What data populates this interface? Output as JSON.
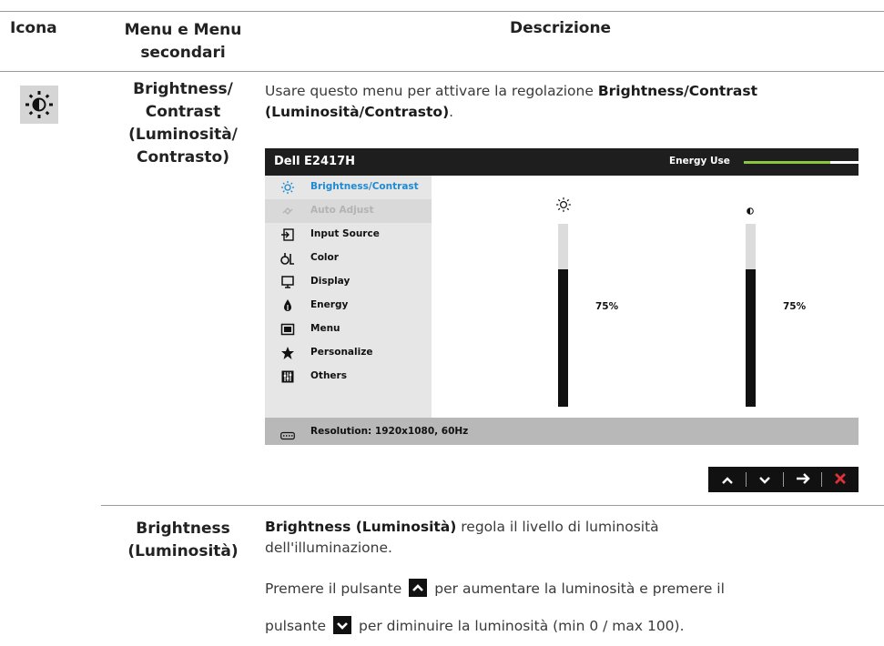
{
  "table": {
    "headers": {
      "icon": "Icona",
      "menu_line1": "Menu e Menu",
      "menu_line2": "secondari",
      "description": "Descrizione"
    }
  },
  "rows": [
    {
      "icon": "brightness-icon",
      "menu_lines": [
        "Brightness/",
        "Contrast",
        "(Luminosità/",
        "Contrasto)"
      ],
      "desc_prefix": "Usare questo menu per attivare la regolazione ",
      "desc_bold": "Brightness/Contrast (Luminosità/Contrasto)",
      "desc_suffix": "."
    },
    {
      "menu_lines": [
        "Brightness",
        "(Luminosità)"
      ],
      "desc_bold": "Brightness (Luminosità)",
      "desc_rest": " regola il livello di luminosità",
      "desc_line2": "dell'illuminazione.",
      "desc_p2_a": "Premere il pulsante",
      "desc_p2_b": "per aumentare la luminosità e premere il",
      "desc_p3_a": "pulsante",
      "desc_p3_b": "per diminuire la luminosità (min 0 / max 100)."
    }
  ],
  "osd": {
    "model": "Dell E2417H",
    "energy_label": "Energy Use",
    "energy_level": 0.75,
    "menu_items": [
      {
        "label": "Brightness/Contrast",
        "icon": "brightness-icon",
        "state": "active"
      },
      {
        "label": "Auto Adjust",
        "icon": "auto-adjust-icon",
        "state": "disabled"
      },
      {
        "label": "Input Source",
        "icon": "input-source-icon",
        "state": "normal"
      },
      {
        "label": "Color",
        "icon": "color-icon",
        "state": "normal"
      },
      {
        "label": "Display",
        "icon": "display-icon",
        "state": "normal"
      },
      {
        "label": "Energy",
        "icon": "energy-icon",
        "state": "normal"
      },
      {
        "label": "Menu",
        "icon": "menu-icon",
        "state": "normal"
      },
      {
        "label": "Personalize",
        "icon": "star-icon",
        "state": "normal"
      },
      {
        "label": "Others",
        "icon": "others-icon",
        "state": "normal"
      }
    ],
    "brightness": {
      "value": 75,
      "label": "75%"
    },
    "contrast": {
      "value": 75,
      "label": "75%"
    },
    "resolution": "Resolution: 1920x1080, 60Hz"
  },
  "nav_buttons": [
    "up-icon",
    "down-icon",
    "right-arrow-icon",
    "close-icon"
  ],
  "colors": {
    "active_item": "#1f8ad1",
    "energy_bar": "#8cc63f",
    "exit_button": "#e0303a"
  }
}
